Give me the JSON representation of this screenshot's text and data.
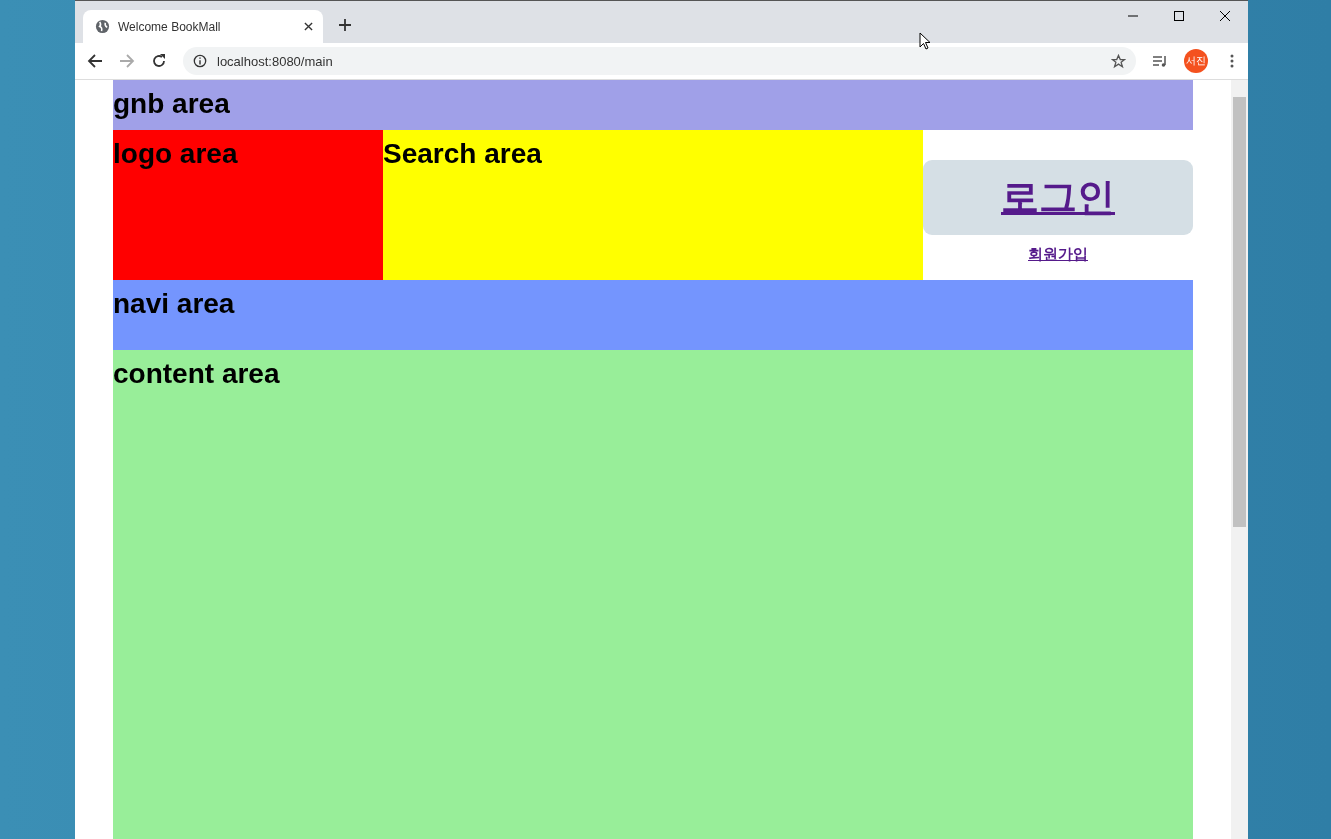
{
  "browser": {
    "tab": {
      "title": "Welcome BookMall"
    },
    "address": "localhost:8080/main",
    "profile": "서진"
  },
  "page": {
    "gnb": "gnb area",
    "logo": "logo area",
    "search": "Search area",
    "login": "로그인",
    "signup": "회원가입",
    "navi": "navi area",
    "content": "content area"
  }
}
